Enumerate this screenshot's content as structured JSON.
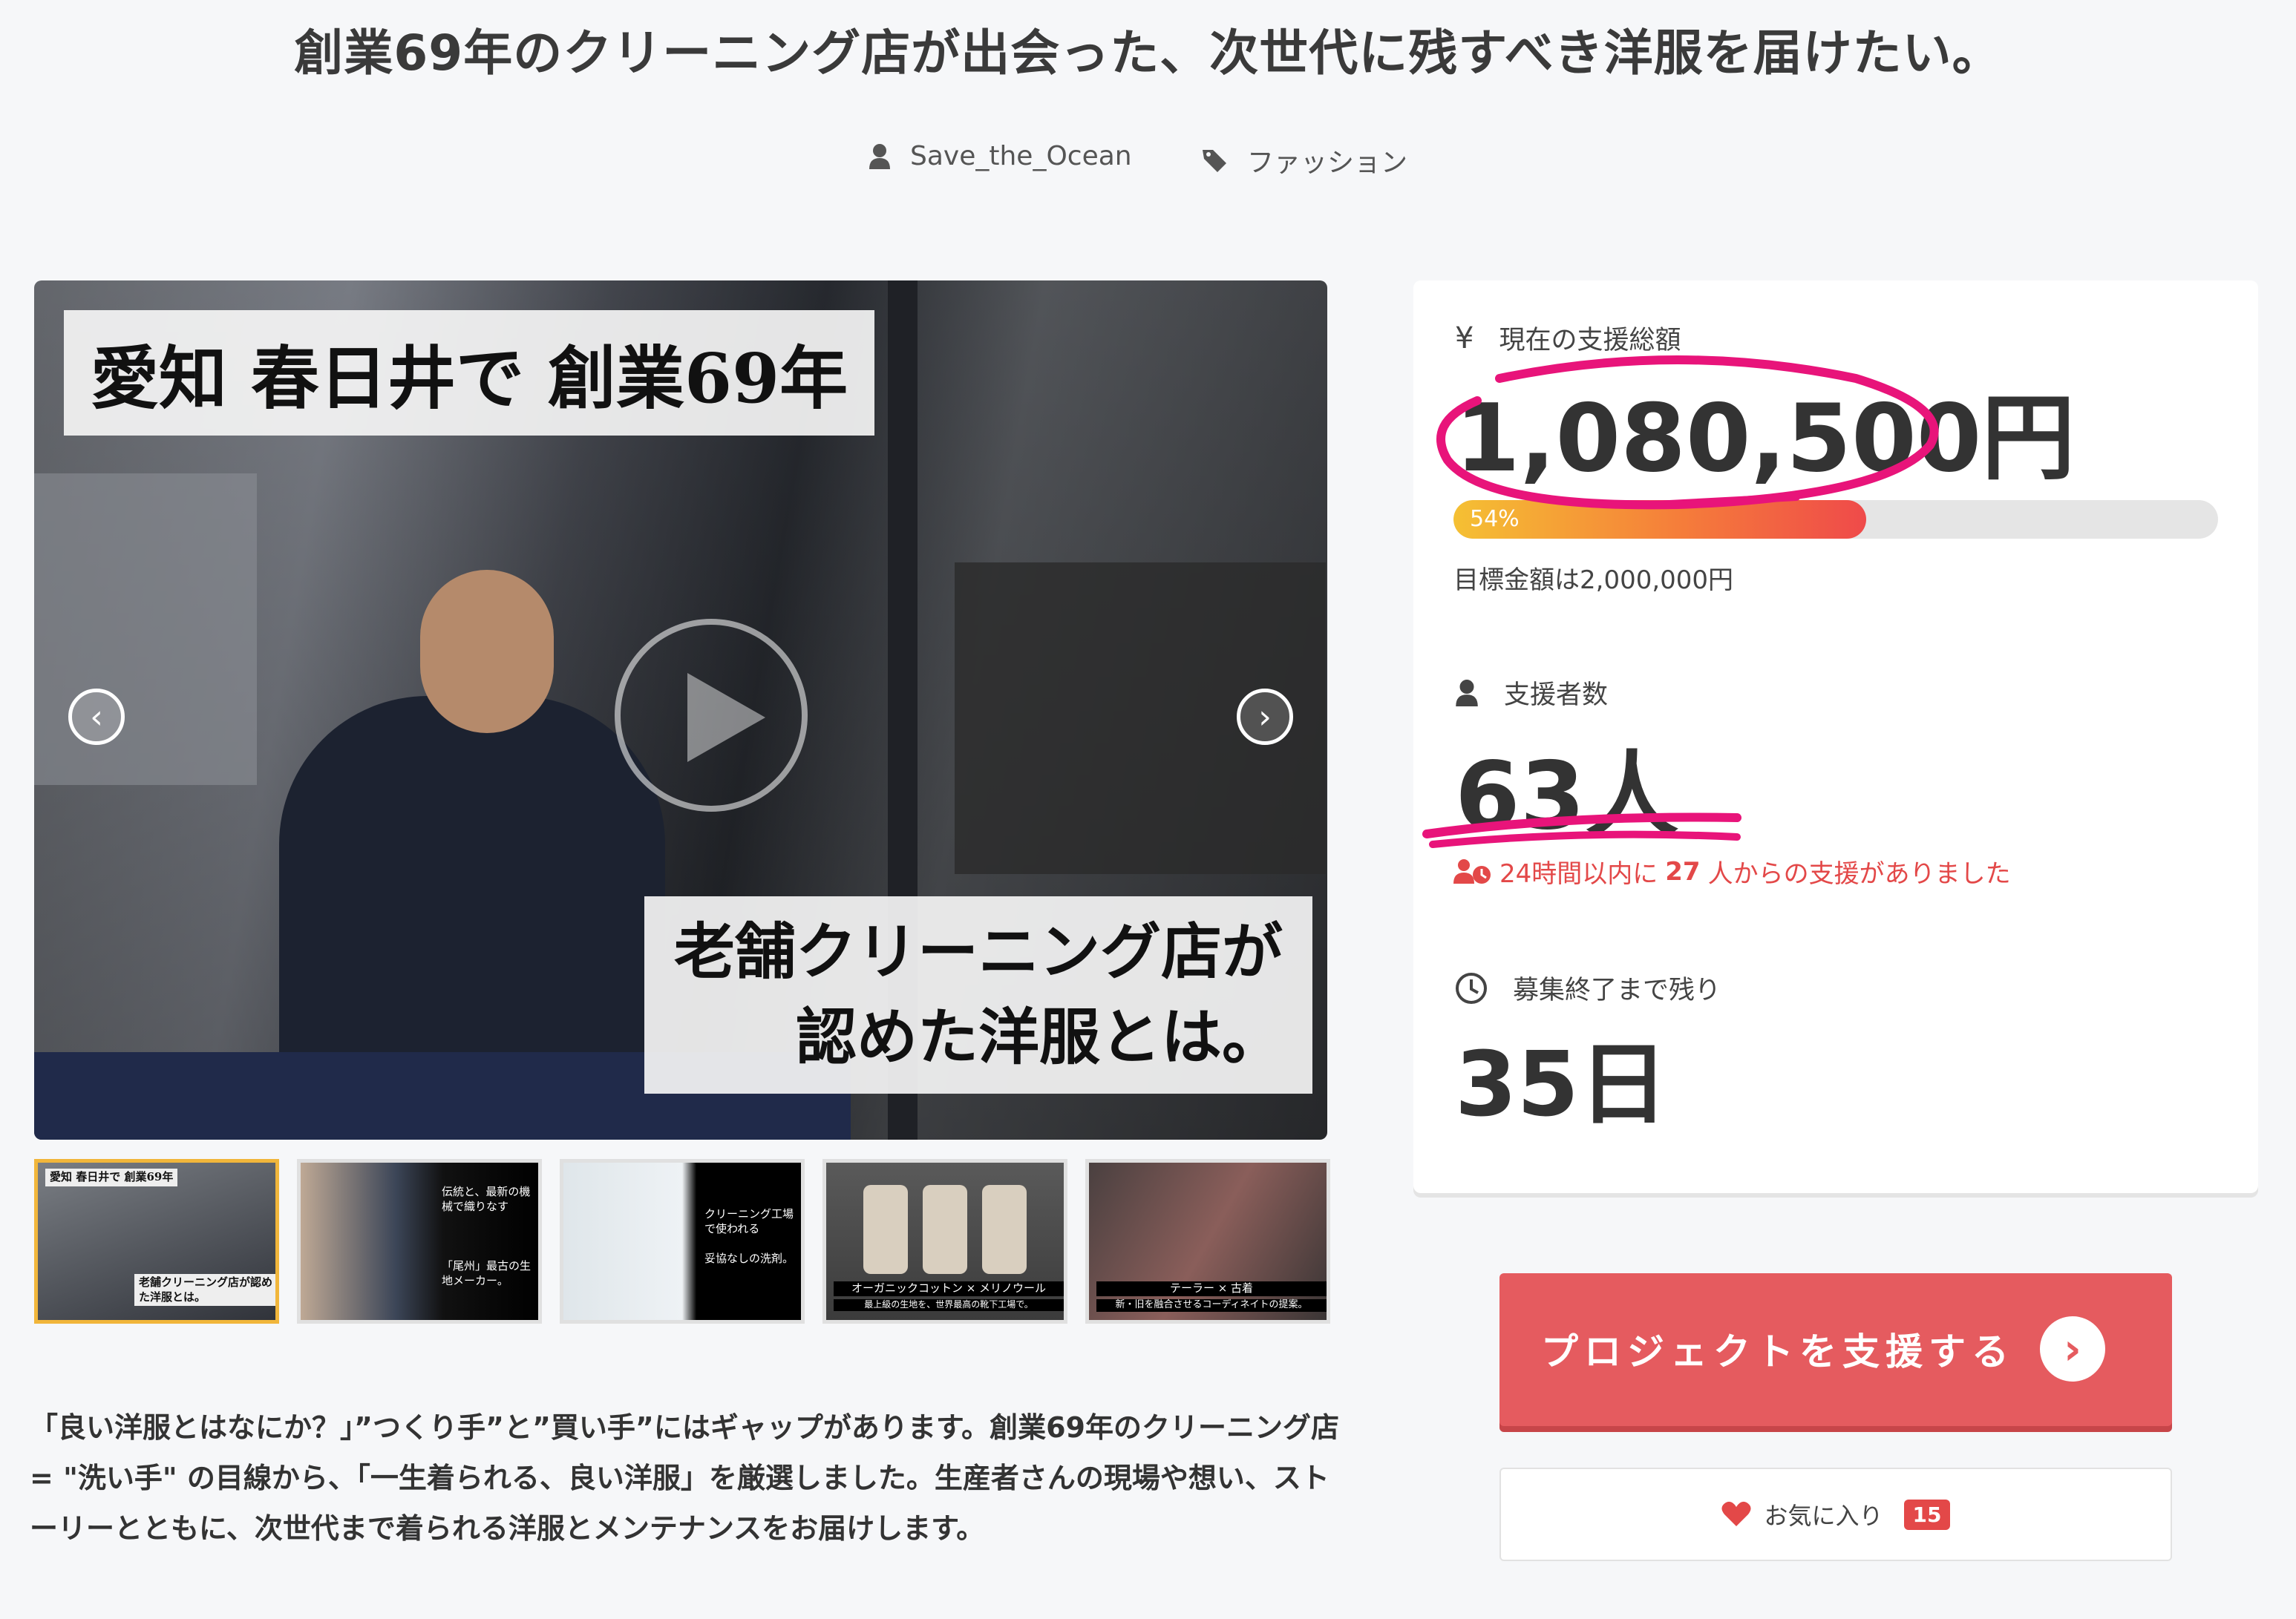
{
  "page": {
    "title": "創業69年のクリーニング店が出会った、次世代に残すべき洋服を届けたい。",
    "author": "Save_the_Ocean",
    "category": "ファッション"
  },
  "hero": {
    "caption_top": "愛知 春日井で 創業69年",
    "caption_bottom_1": "老舗クリーニング店が",
    "caption_bottom_2": "認めた洋服とは。"
  },
  "thumbnails": [
    {
      "caption": "愛知 春日井で 創業69年",
      "caption2": "老舗クリーニング店が認めた洋服とは。",
      "active": true
    },
    {
      "caption": "伝統と、最新の機械で織りなす",
      "caption2": "「尾州」最古の生地メーカー。",
      "active": false
    },
    {
      "caption": "クリーニング工場で使われる",
      "caption2": "妥協なしの洗剤。",
      "active": false
    },
    {
      "caption": "オーガニックコットン × メリノウール",
      "caption2": "最上級の生地を、世界最高の靴下工場で。",
      "active": false
    },
    {
      "caption": "テーラー × 古着",
      "caption2": "新・旧を融合させるコーディネイトの提案。",
      "active": false
    }
  ],
  "description": "「良い洋服とはなにか？」”つくり手”と”買い手”にはギャップがあります。創業69年のクリーニング店 = \"洗い手\" の目線から、「一生着られる、良い洋服」を厳選しました。生産者さんの現場や想い、ストーリーとともに、次世代まで着られる洋服とメンテナンスをお届けします。",
  "stats": {
    "total_label": "現在の支援総額",
    "currency_symbol": "¥",
    "total_amount": "1,080,500円",
    "progress_percent": 54,
    "progress_label": "54%",
    "goal_text": "目標金額は2,000,000円",
    "supporters_label": "支援者数",
    "supporters_count": "63人",
    "recent_prefix": "24時間以内に",
    "recent_count": "27",
    "recent_suffix": "人からの支援がありました",
    "remaining_label": "募集終了まで残り",
    "remaining_days": "35日"
  },
  "actions": {
    "support_label": "プロジェクトを支援する",
    "favorite_label": "お気に入り",
    "favorite_count": "15"
  },
  "colors": {
    "accent": "#e55b5f",
    "annotation": "#e8147a",
    "active_thumb": "#f1b63b"
  }
}
